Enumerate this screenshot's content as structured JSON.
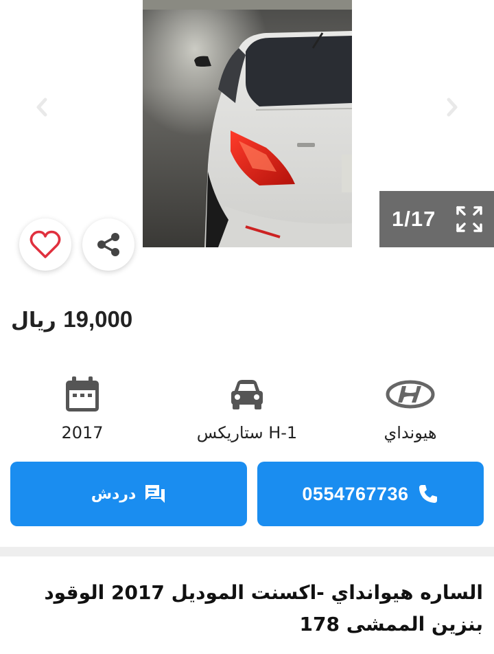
{
  "gallery": {
    "counter": "1/17",
    "icons": {
      "prev": "chevron-left-icon",
      "next": "chevron-right-icon",
      "fullscreen": "expand-icon",
      "favorite": "heart-icon",
      "share": "share-icon"
    }
  },
  "listing": {
    "price": "19,000",
    "currency": "ريال"
  },
  "specs": {
    "year": "2017",
    "model": "H-1 ستاريكس",
    "brand": "هيونداي",
    "icons": {
      "year": "calendar-icon",
      "model": "car-icon",
      "brand": "hyundai-logo-icon"
    }
  },
  "actions": {
    "chat_label": "دردش",
    "call_label": "0554767736",
    "primary_color": "#1a8df0"
  },
  "description": {
    "line1": "الساره هيوانداي -اكسنت الموديل 2017 الوقود",
    "line2": "بنزين الممشى 178"
  },
  "colors": {
    "heart": "#e0303e",
    "counter_bg": "#6b6b6b"
  }
}
